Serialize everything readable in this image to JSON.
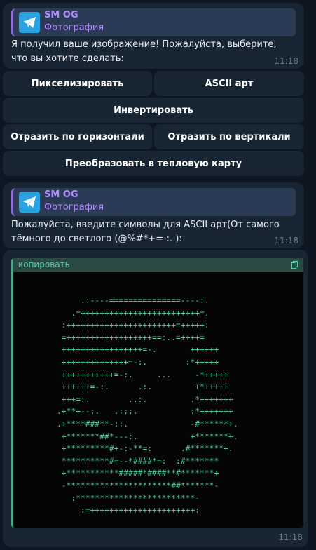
{
  "message1": {
    "reply_name": "SM OG",
    "reply_type": "Фотография",
    "text": "Я получил ваше изображение! Пожалуйста, выберите, что вы хотите сделать:",
    "time": "11:18"
  },
  "keyboard": {
    "pixelate": "Пикселизировать",
    "ascii": "ASCII арт",
    "invert": "Инвертировать",
    "flip_h": "Отразить по горизонтали",
    "flip_v": "Отразить по вертикали",
    "heatmap": "Преобразовать в тепловую карту"
  },
  "message2": {
    "reply_name": "SM OG",
    "reply_type": "Фотография",
    "text": "Пожалуйста, введите символы для ASCII арт(От самого тёмного до светлого (@%#*+=-:. ):",
    "time": "11:18"
  },
  "code_message": {
    "label": "копировать",
    "art": "          .:----===============----:.\n        .=+++++++++++++++++++++++++=.\n      :+++++++++++++++++++++++=+++++:\n      =++++++++++++++++++==:..=++++=\n      +++++++++++++++++=-.       ++++++\n      ++++++++++++++=-:.        :*+++++\n      +++++++++++=-:.     ...     -*+++++\n      ++++++=-:.      .:.         +*+++++\n      +++=:.        ..:.         .*+++++++\n     .+**+--:.   .:::.           :*+++++++\n     .+****###**-::.             -#******+.\n      +*******##*---:.           +*******+.\n      +*********#+-:-**=:      .#*******+.\n      **********#=--*####*=:  :#*******\n      +***********#####*####**#*******+\n      -**********************##*******-\n        :*************************-\n          :=++++++++++++++++++++++:",
    "time": "11:18"
  },
  "colors": {
    "background": "#0e1621",
    "bubble": "#182533",
    "reply_accent": "#b08cff",
    "code_text": "#4ec9a6"
  },
  "icons": {
    "reply_thumb": "telegram-plane-icon",
    "copy": "copy-icon"
  }
}
